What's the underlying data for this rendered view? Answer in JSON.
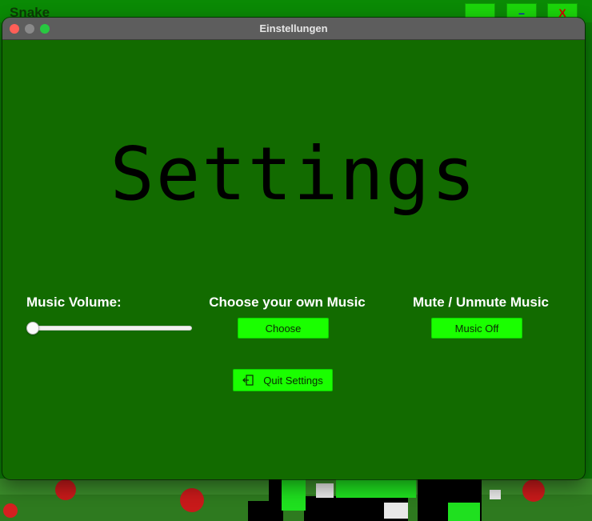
{
  "background_game": {
    "title": "Snake",
    "buttons": [
      {
        "label": ""
      },
      {
        "label": "–"
      },
      {
        "label": "X"
      }
    ]
  },
  "window": {
    "title": "Einstellungen"
  },
  "settings": {
    "heading": "Settings",
    "volume": {
      "label": "Music Volume:",
      "value": 0
    },
    "custom_music": {
      "label": "Choose your own Music",
      "button": "Choose"
    },
    "mute": {
      "label": "Mute / Unmute Music",
      "button": "Music Off"
    },
    "quit_button": "Quit Settings"
  },
  "colors": {
    "window_bg": "#126b00",
    "button_bg": "#1aff00",
    "label_text": "#ffffff",
    "heading_text": "#000000"
  },
  "icons": {
    "quit": "exit-door-icon"
  }
}
